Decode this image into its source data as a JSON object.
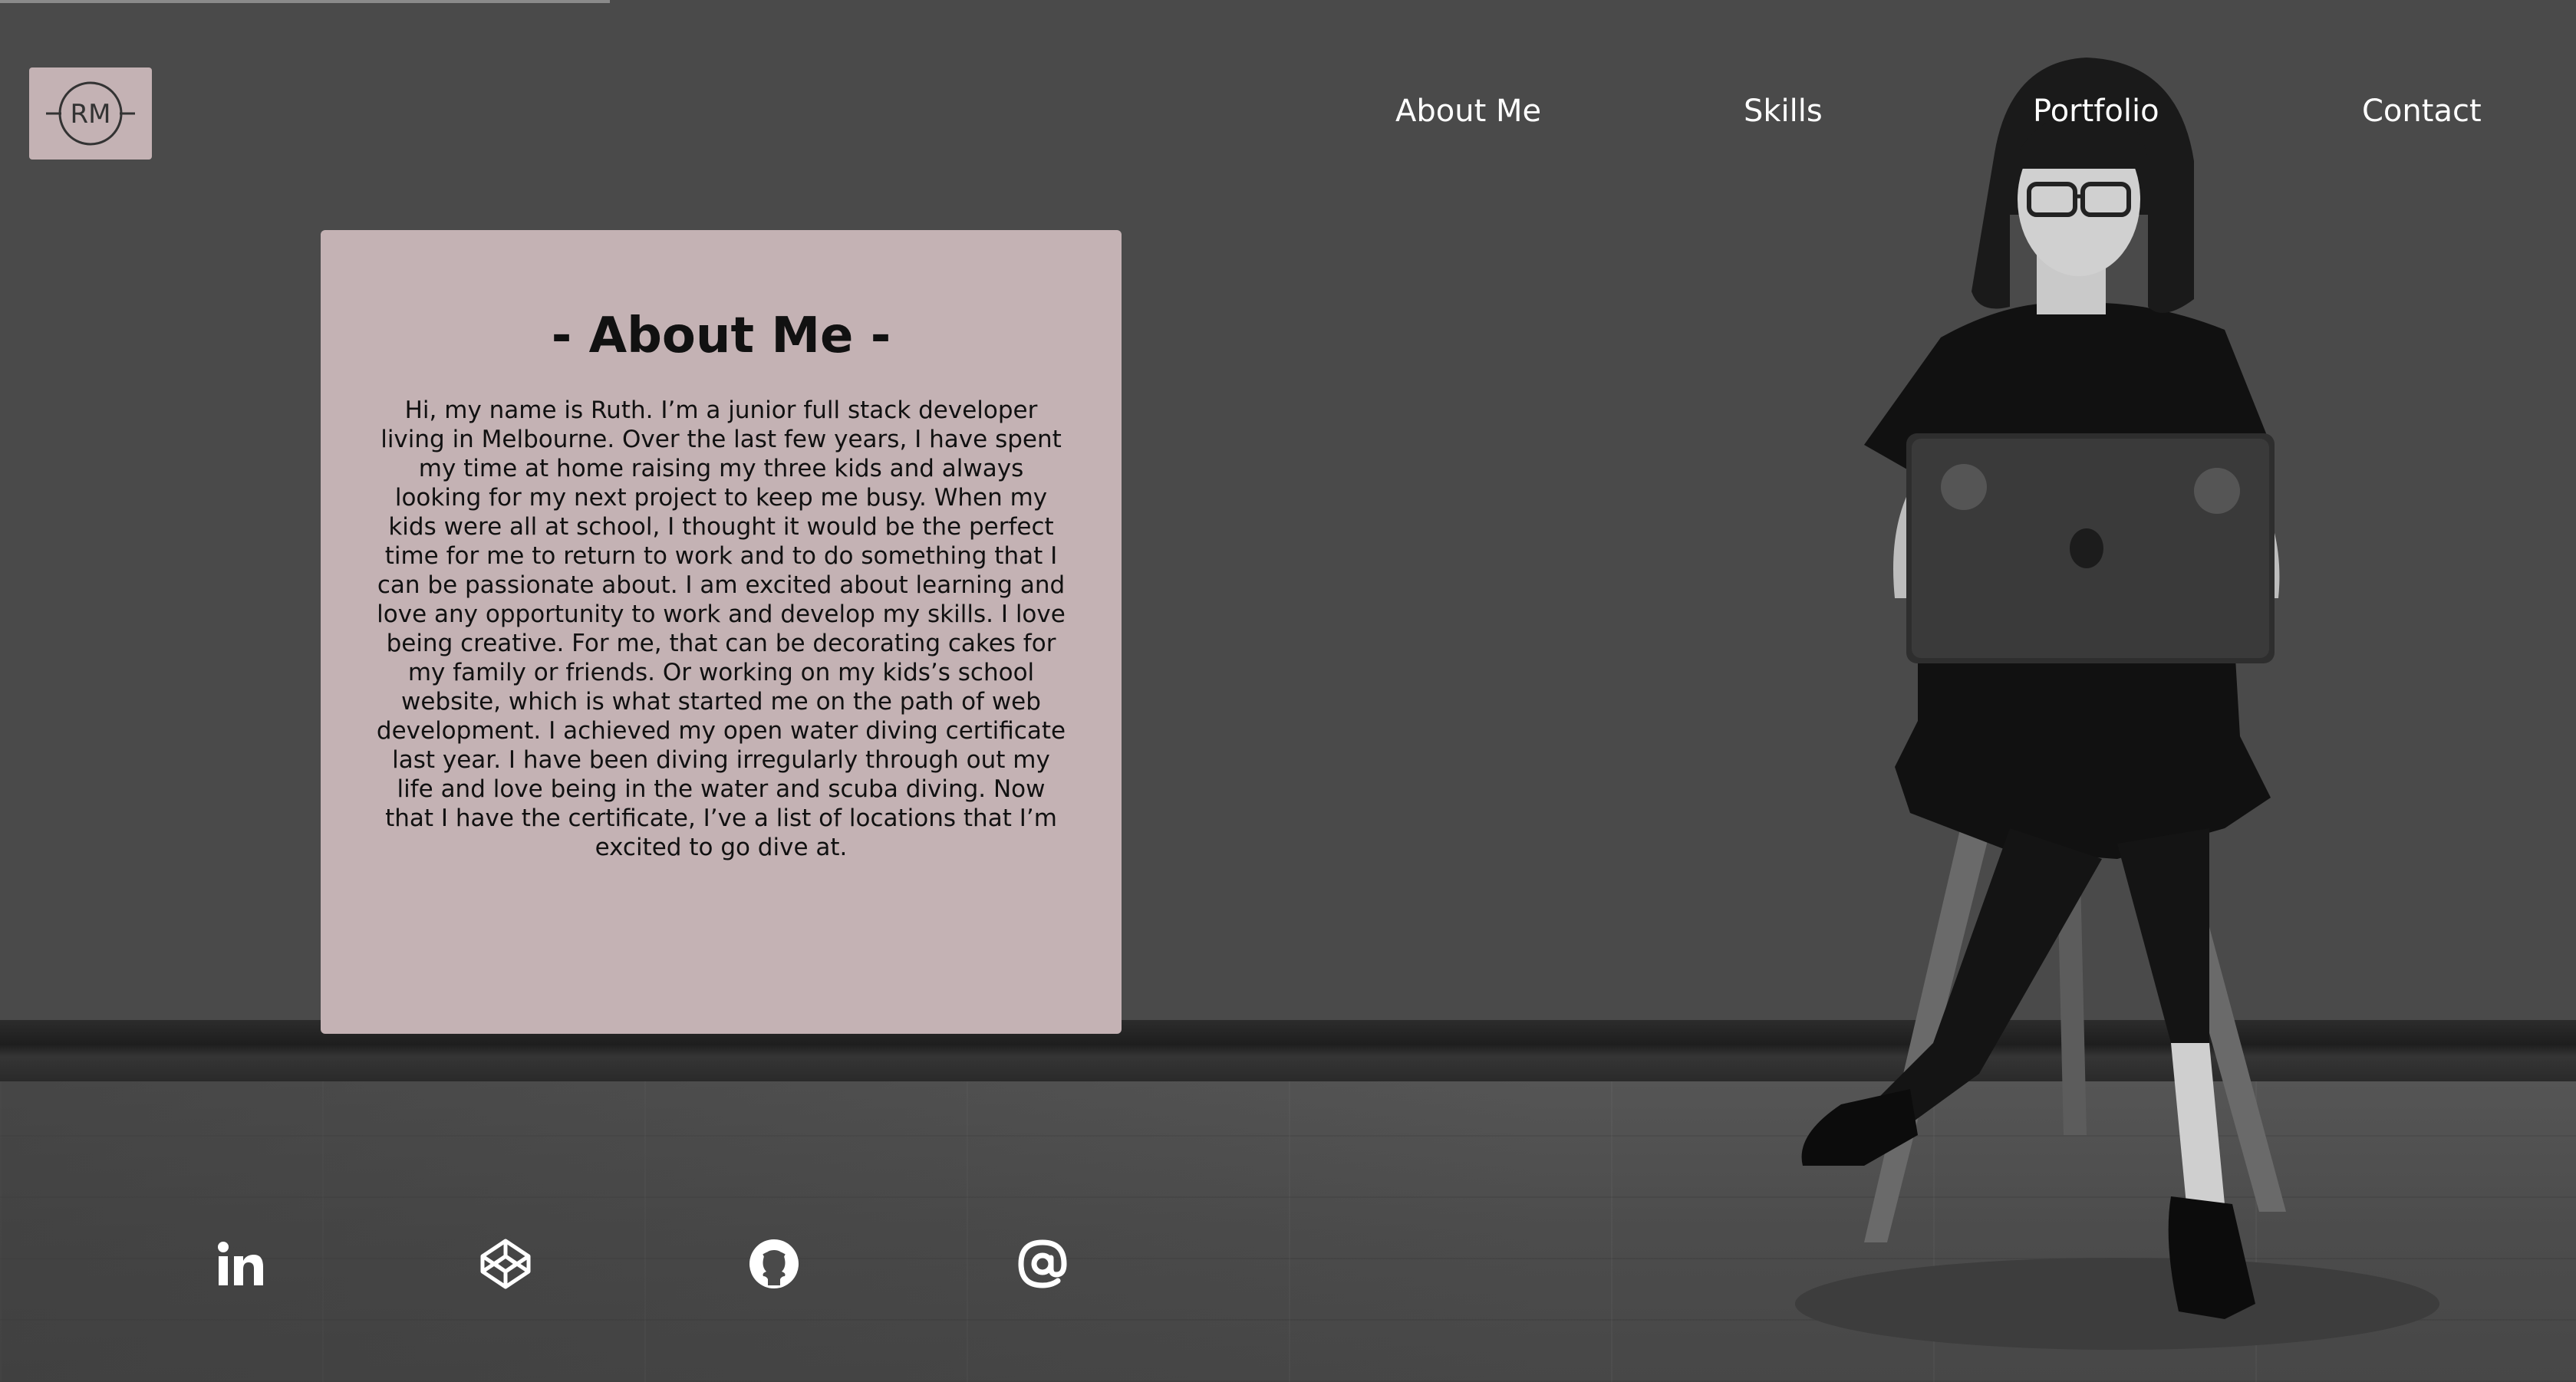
{
  "logo": {
    "text": "RM",
    "icon": "rm-monogram-logo"
  },
  "nav": [
    {
      "label": "About Me"
    },
    {
      "label": "Skills"
    },
    {
      "label": "Portfolio"
    },
    {
      "label": "Contact"
    }
  ],
  "about": {
    "title": "- About Me -",
    "body": "Hi, my name is Ruth. I’m a junior full stack developer living in Melbourne. Over the last few years, I have spent my time at home raising my three kids and always looking for my next project to keep me busy. When my kids were all at school, I thought it would be the perfect time for me to return to work and to do something that I can be passionate about. I am excited about learning and love any opportunity to work and develop my skills. I love being creative. For me, that can be decorating cakes for my family or friends. Or working on my kids’s school website, which is what started me on the path of web development. I achieved my open water diving certificate last year. I have been diving irregularly through out my life and love being in the water and scuba diving. Now that I have the certificate, I’ve a list of locations that I’m excited to go dive at."
  },
  "social": [
    {
      "icon": "linkedin-icon"
    },
    {
      "icon": "codepen-icon"
    },
    {
      "icon": "github-icon"
    },
    {
      "icon": "at-sign-icon"
    }
  ],
  "colors": {
    "background": "#4a4a4a",
    "card": "#c4b2b4",
    "nav_text": "#ffffff"
  }
}
